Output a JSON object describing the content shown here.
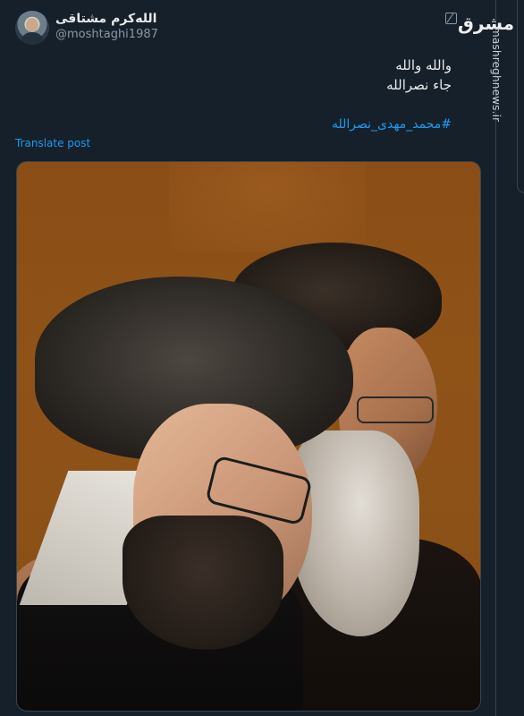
{
  "post": {
    "author_name": "الله‌کرم مشتاقی",
    "author_handle": "@moshtaghi1987",
    "text_line1": "والله والله",
    "text_line2": "جاء نصرالله",
    "hashtag": "#محمد_مهدی_نصرالله",
    "translate_label": "Translate post"
  },
  "watermark": {
    "site": "mashreghnews.ir",
    "logo": "مشرق"
  },
  "colors": {
    "background": "#15202b",
    "link": "#1d9bf0",
    "text": "#e7e9ea",
    "muted": "#8b98a5"
  },
  "icons": {
    "edit": "edit-icon"
  }
}
